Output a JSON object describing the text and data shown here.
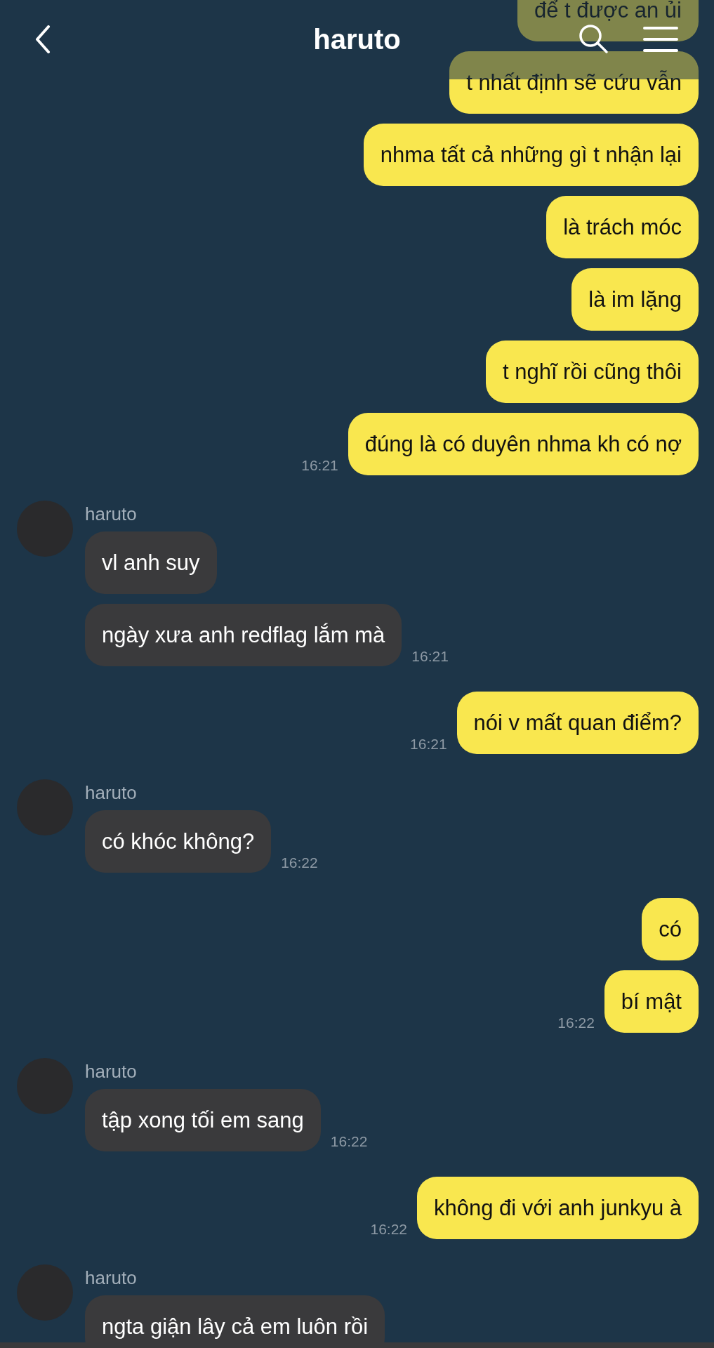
{
  "header": {
    "title": "haruto"
  },
  "groups": [
    {
      "kind": "sent",
      "messages": [
        "để t được an ủi",
        "t nhất định sẽ cứu vẫn",
        "nhma tất cả những gì t nhận lại",
        "là trách móc",
        "là im lặng",
        "t nghĩ rồi cũng thôi",
        "đúng là có duyên nhma kh có nợ"
      ],
      "time": "16:21"
    },
    {
      "kind": "received",
      "name": "haruto",
      "messages": [
        "vl anh suy",
        "ngày xưa anh redflag lắm mà"
      ],
      "time": "16:21"
    },
    {
      "kind": "sent",
      "messages": [
        "nói v mất quan điểm?"
      ],
      "time": "16:21"
    },
    {
      "kind": "received",
      "name": "haruto",
      "messages": [
        "có khóc không?"
      ],
      "time": "16:22"
    },
    {
      "kind": "sent",
      "messages": [
        "có",
        "bí mật"
      ],
      "time": "16:22"
    },
    {
      "kind": "received",
      "name": "haruto",
      "messages": [
        "tập xong tối em sang"
      ],
      "time": "16:22"
    },
    {
      "kind": "sent",
      "messages": [
        "không đi với anh junkyu à"
      ],
      "time": "16:22"
    },
    {
      "kind": "received",
      "name": "haruto",
      "messages": [
        "ngta giận lây cả em luôn rồi"
      ]
    }
  ]
}
